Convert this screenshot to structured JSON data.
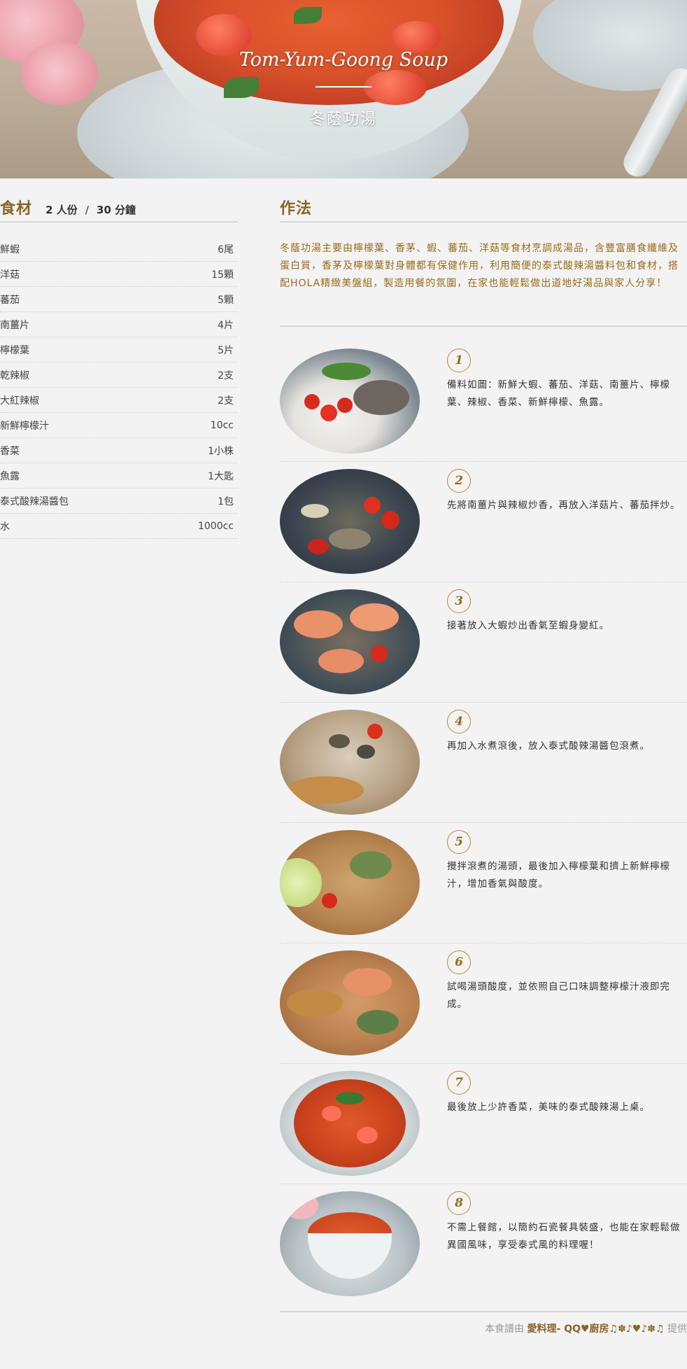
{
  "hero": {
    "title_en": "Tom-Yum-Goong Soup",
    "title_zh": "冬蔭功湯"
  },
  "ingredients": {
    "heading": "食材",
    "servings": "2 人份",
    "separator": "/",
    "time": "30 分鐘",
    "items": [
      {
        "name": "鮮蝦",
        "qty": "6尾"
      },
      {
        "name": "洋菇",
        "qty": "15顆"
      },
      {
        "name": "蕃茄",
        "qty": "5顆"
      },
      {
        "name": "南薑片",
        "qty": "4片"
      },
      {
        "name": "檸檬葉",
        "qty": "5片"
      },
      {
        "name": "乾辣椒",
        "qty": "2支"
      },
      {
        "name": "大紅辣椒",
        "qty": "2支"
      },
      {
        "name": "新鮮檸檬汁",
        "qty": "10cc"
      },
      {
        "name": "香菜",
        "qty": "1小株"
      },
      {
        "name": "魚露",
        "qty": "1大匙"
      },
      {
        "name": "泰式酸辣湯醬包",
        "qty": "1包"
      },
      {
        "name": "水",
        "qty": "1000cc"
      }
    ]
  },
  "method": {
    "heading": "作法",
    "intro": "冬蔭功湯主要由檸檬葉、香茅、蝦、蕃茄、洋菇等食材烹調成湯品，含豐富膳食纖維及蛋白質，香茅及檸檬葉對身體都有保健作用，利用簡便的泰式酸辣湯醬料包和食材，搭配HOLA精緻美盤組，製造用餐的氛圍，在家也能輕鬆做出道地好湯品與家人分享！",
    "steps": [
      {
        "num": "1",
        "text": "備料如圖：新鮮大蝦、蕃茄、洋菇、南薑片、檸檬葉、辣椒、香菜、新鮮檸檬、魚露。"
      },
      {
        "num": "2",
        "text": "先將南薑片與辣椒炒香，再放入洋菇片、蕃茄拌炒。"
      },
      {
        "num": "3",
        "text": "接著放入大蝦炒出香氣至蝦身變紅。"
      },
      {
        "num": "4",
        "text": "再加入水煮滾後，放入泰式酸辣湯醬包滾煮。"
      },
      {
        "num": "5",
        "text": "攪拌滾煮的湯頭，最後加入檸檬葉和擠上新鮮檸檬汁，增加香氣與酸度。"
      },
      {
        "num": "6",
        "text": "試喝湯頭酸度，並依照自己口味調整檸檬汁液即完成。"
      },
      {
        "num": "7",
        "text": "最後放上少許香菜，美味的泰式酸辣湯上桌。"
      },
      {
        "num": "8",
        "text": "不需上餐館，以簡約石瓷餐具裝盛，也能在家輕鬆做異國風味，享受泰式風的料理喔！"
      }
    ]
  },
  "credit": {
    "prefix": "本食譜由",
    "author": "愛料理- QQ♥廚房♫✽♪♥♪✽♫",
    "suffix": "提供"
  }
}
